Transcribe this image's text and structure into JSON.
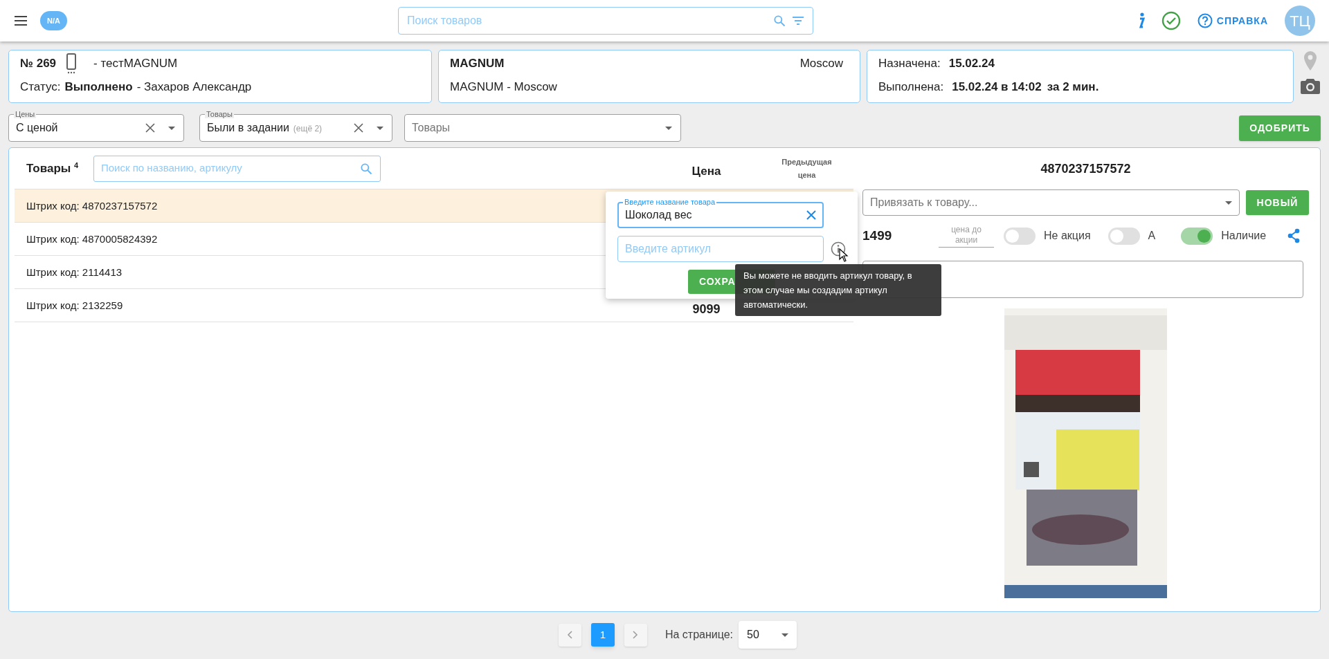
{
  "top_bar": {
    "badge": "N/A",
    "search": {
      "placeholder": "Поиск товаров"
    },
    "help": "СПРАВКА",
    "avatar": "ТЦ"
  },
  "task": {
    "number": "№ 269",
    "device": "- тестMAGNUM",
    "status_label": "Статус:",
    "status": "Выполнено",
    "assignee": "- Захаров Александр"
  },
  "store": {
    "name": "MAGNUM",
    "city": "Moscow",
    "address": "MAGNUM - Moscow"
  },
  "dates": {
    "assigned_label": "Назначена:",
    "assigned": "15.02.24",
    "done_label": "Выполнена:",
    "done": "15.02.24 в 14:02",
    "duration": "за 2 мин."
  },
  "filters": [
    {
      "label": "Цены",
      "value": "С ценой",
      "clearable": true
    },
    {
      "label": "Товары",
      "value": "Были в задании",
      "extra": "(ещё 2)",
      "clearable": true
    },
    {
      "placeholder": "Товары",
      "clearable": false
    }
  ],
  "approve_button": "ОДОБРИТЬ",
  "products": {
    "title": "Товары",
    "count": "4",
    "search": {
      "placeholder": "Поиск по названию, артикулу"
    },
    "columns": [
      "Цена",
      "Предыдущая цена"
    ],
    "rows": [
      {
        "barcode": "Штрих код: 4870237157572",
        "selected": true
      },
      {
        "barcode": "Штрих код: 4870005824392",
        "selected": false
      },
      {
        "barcode": "Штрих код: 2114413",
        "selected": false
      },
      {
        "barcode": "Штрих код: 2132259",
        "price": "9099",
        "selected": false
      }
    ]
  },
  "detail": {
    "barcode": "4870237157572",
    "link": {
      "placeholder": "Привязать к товару..."
    },
    "new_button": "НОВЫЙ",
    "price": "1499",
    "promo_price_label": "цена до акции",
    "toggles": [
      {
        "label": "Не акция",
        "on": false
      },
      {
        "label": "А",
        "on": false
      },
      {
        "label": "Наличие",
        "on": true
      }
    ]
  },
  "popup": {
    "name_field": {
      "label": "Введите название товара",
      "value": "Шоколад вес"
    },
    "article_field": {
      "placeholder": "Введите артикул"
    },
    "save_button": "СОХРА"
  },
  "tooltip": "Вы можете не вводить артикул товару, в этом случае мы создадим артикул автоматически.",
  "pagination": {
    "pages": [
      {
        "label": "1",
        "selected": true
      }
    ],
    "per_page_label": "На странице:",
    "per_page": "50"
  }
}
